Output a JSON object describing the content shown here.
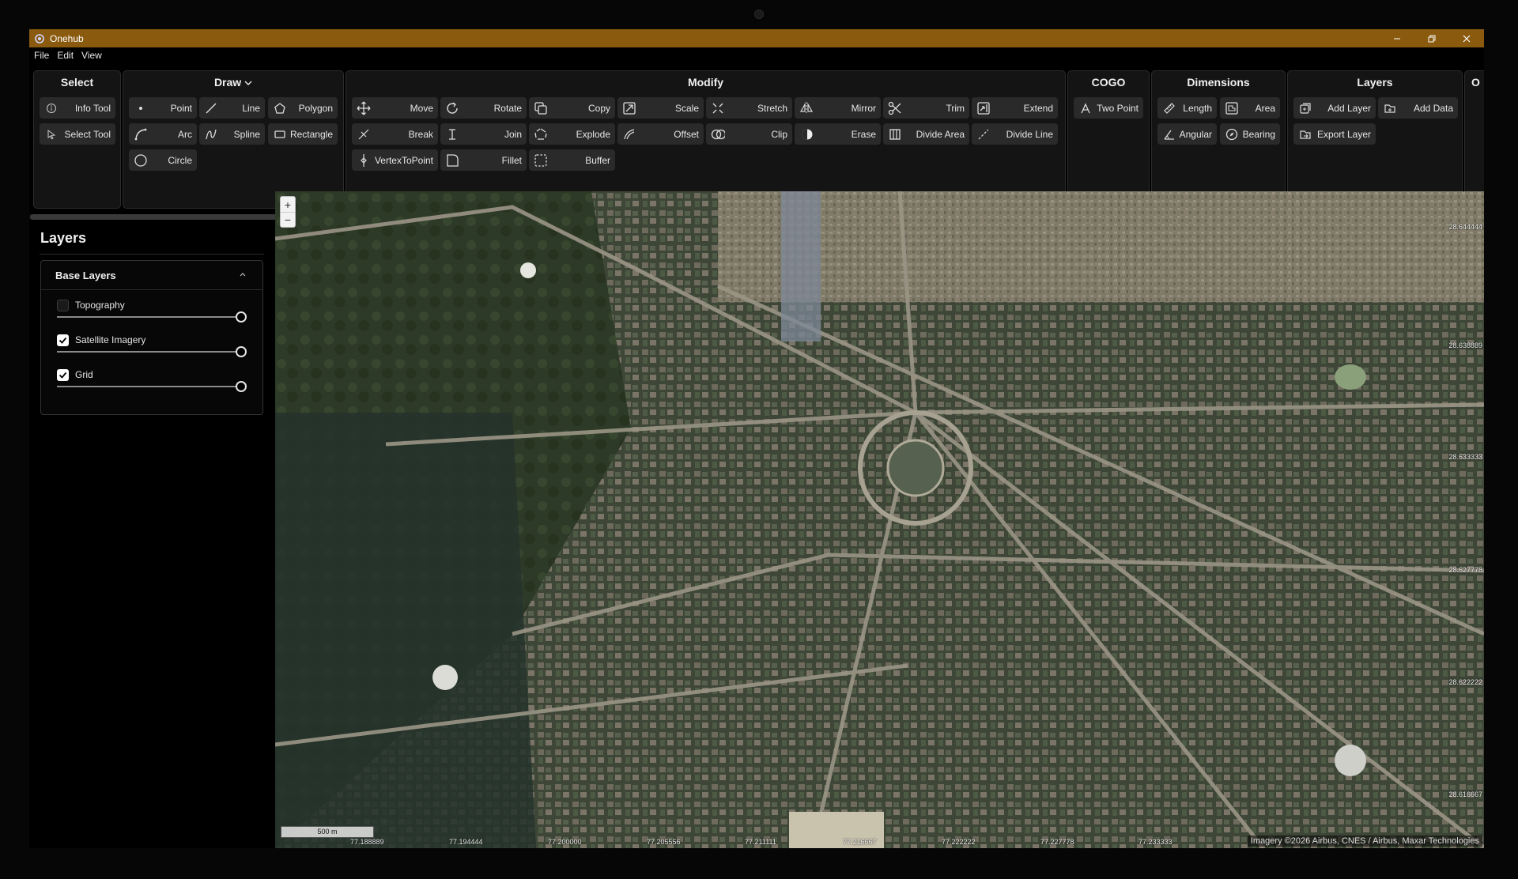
{
  "window": {
    "title": "Onehub",
    "controls": [
      "minimize-icon",
      "restore-icon",
      "close-icon"
    ]
  },
  "menu": [
    "File",
    "Edit",
    "View"
  ],
  "ribbon": {
    "select": {
      "title": "Select",
      "buttons": [
        {
          "label": "Info Tool",
          "icon": "info-icon"
        },
        {
          "label": "Select Tool",
          "icon": "select-cursor-icon"
        }
      ]
    },
    "draw": {
      "title": "Draw",
      "buttons": [
        {
          "label": "Point",
          "icon": "point-icon"
        },
        {
          "label": "Line",
          "icon": "line-icon"
        },
        {
          "label": "Polygon",
          "icon": "polygon-icon"
        },
        {
          "label": "Arc",
          "icon": "arc-icon"
        },
        {
          "label": "Spline",
          "icon": "spline-icon"
        },
        {
          "label": "Rectangle",
          "icon": "rectangle-icon"
        },
        {
          "label": "Circle",
          "icon": "circle-icon"
        }
      ]
    },
    "modify": {
      "title": "Modify",
      "buttons": [
        {
          "label": "Move",
          "icon": "move-icon"
        },
        {
          "label": "Rotate",
          "icon": "rotate-icon"
        },
        {
          "label": "Copy",
          "icon": "copy-icon"
        },
        {
          "label": "Scale",
          "icon": "scale-icon"
        },
        {
          "label": "Stretch",
          "icon": "stretch-icon"
        },
        {
          "label": "Mirror",
          "icon": "mirror-icon"
        },
        {
          "label": "Trim",
          "icon": "scissors-icon"
        },
        {
          "label": "Extend",
          "icon": "extend-icon"
        },
        {
          "label": "Break",
          "icon": "break-icon"
        },
        {
          "label": "Join",
          "icon": "join-icon"
        },
        {
          "label": "Explode",
          "icon": "explode-icon"
        },
        {
          "label": "Offset",
          "icon": "offset-icon"
        },
        {
          "label": "Clip",
          "icon": "clip-icon"
        },
        {
          "label": "Erase",
          "icon": "erase-icon"
        },
        {
          "label": "Divide Area",
          "icon": "divide-area-icon"
        },
        {
          "label": "Divide Line",
          "icon": "divide-line-icon"
        },
        {
          "label": "VertexToPoint",
          "icon": "vertex-to-point-icon"
        },
        {
          "label": "Fillet",
          "icon": "fillet-icon"
        },
        {
          "label": "Buffer",
          "icon": "buffer-icon"
        }
      ]
    },
    "cogo": {
      "title": "COGO",
      "buttons": [
        {
          "label": "Two Point",
          "icon": "two-point-icon"
        }
      ]
    },
    "dimensions": {
      "title": "Dimensions",
      "buttons": [
        {
          "label": "Length",
          "icon": "ruler-icon"
        },
        {
          "label": "Area",
          "icon": "area-icon"
        },
        {
          "label": "Angular",
          "icon": "angle-icon"
        },
        {
          "label": "Bearing",
          "icon": "compass-icon"
        }
      ]
    },
    "layers": {
      "title": "Layers",
      "buttons": [
        {
          "label": "Add Layer",
          "icon": "add-layer-icon"
        },
        {
          "label": "Add Data",
          "icon": "add-data-icon"
        },
        {
          "label": "Export Layer",
          "icon": "export-layer-icon"
        }
      ]
    },
    "overflow": {
      "title": "O"
    }
  },
  "sidebar": {
    "title": "Layers",
    "panel": {
      "title": "Base Layers",
      "expanded": true,
      "layers": [
        {
          "name": "Topography",
          "checked": false,
          "opacity": 1.0
        },
        {
          "name": "Satellite Imagery",
          "checked": true,
          "opacity": 1.0
        },
        {
          "name": "Grid",
          "checked": true,
          "opacity": 1.0
        }
      ]
    }
  },
  "map": {
    "zoom_in": "+",
    "zoom_out": "−",
    "scale_label": "500 m",
    "longitudes": [
      "77.188889",
      "77.194444",
      "77.200000",
      "77.205556",
      "77.211111",
      "77.216667",
      "77.222222",
      "77.227778",
      "77.233333"
    ],
    "latitudes": [
      "28.644444",
      "28.638889",
      "28.633333",
      "28.627778",
      "28.622222",
      "28.616667"
    ],
    "attribution": "Imagery ©2026 Airbus, CNES / Airbus, Maxar Technologies"
  }
}
